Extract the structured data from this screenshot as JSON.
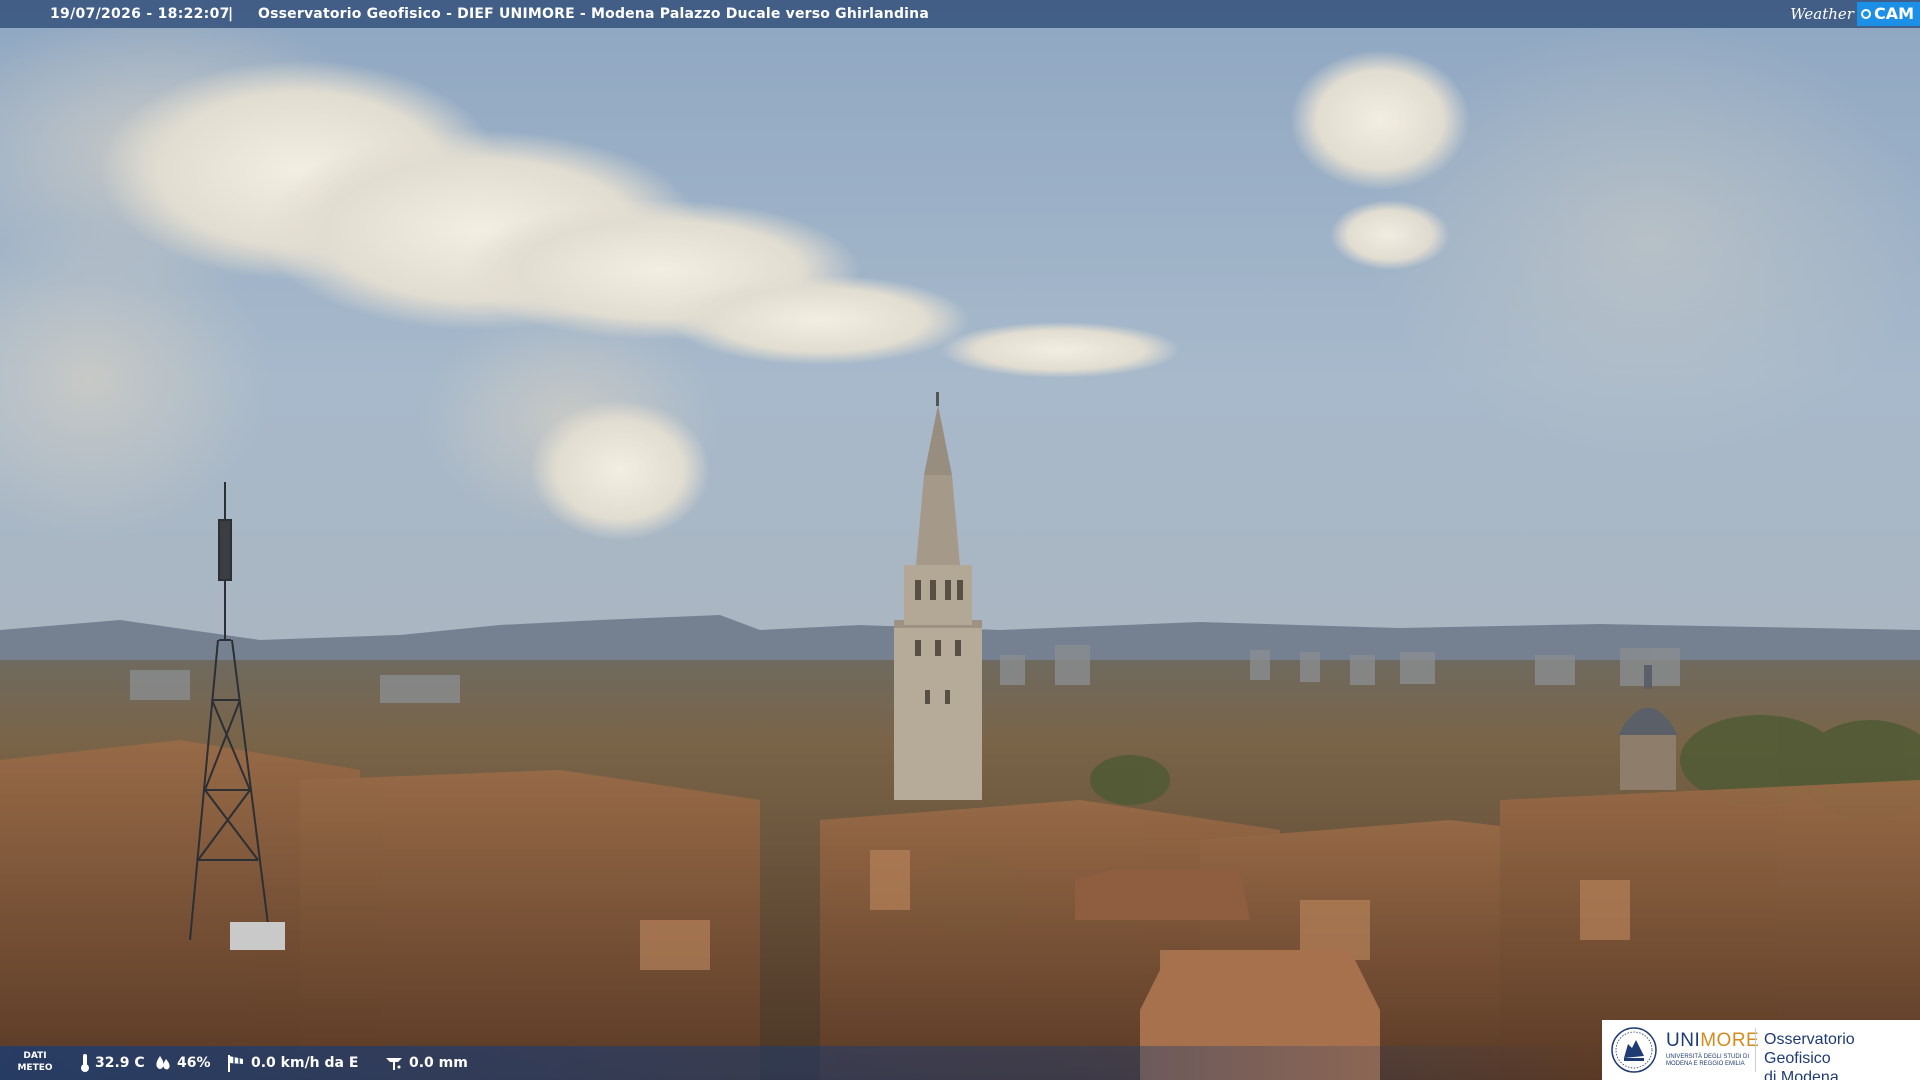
{
  "overlay": {
    "timestamp": "19/07/2026 - 18:22:07",
    "separator": "|",
    "camera_title": "Osservatorio Geofisico - DIEF UNIMORE - Modena Palazzo Ducale verso Ghirlandina",
    "brand_weather": "Weather",
    "brand_cam": "CAM"
  },
  "weather": {
    "label_line1": "DATI",
    "label_line2": "METEO",
    "temperature": "32.9 C",
    "humidity": "46%",
    "wind": "0.0 km/h da E",
    "rain": "0.0 mm"
  },
  "logo": {
    "uni_part1": "UNI",
    "uni_part2": "MORE",
    "uni_subtitle": "UNIVERSITÀ DEGLI STUDI DI MODENA E REGGIO EMILIA",
    "observatory_line1": "Osservatorio Geofisico",
    "observatory_line2": "di Modena"
  },
  "colors": {
    "bar_blue": "#244270",
    "brand_blue": "#1c8fe6",
    "unimore_blue": "#1f3b73",
    "unimore_orange": "#d38b1f"
  },
  "icons": {
    "temperature": "thermometer-icon",
    "humidity": "droplet-icon",
    "wind": "windsock-icon",
    "rain": "rain-gauge-icon"
  }
}
